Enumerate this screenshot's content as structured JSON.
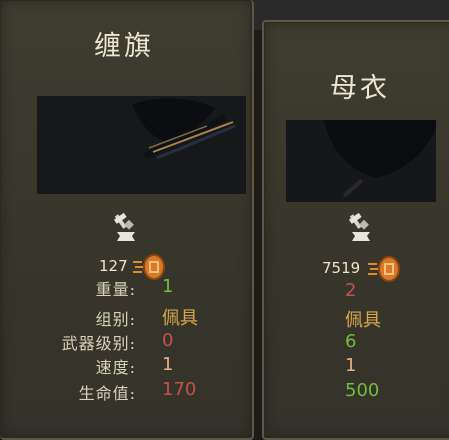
{
  "left_card": {
    "title": "缠旗",
    "price": "127",
    "stats": [
      {
        "label": "重量:",
        "value": "1",
        "color": "#6fbf3a"
      },
      {
        "label": "组别:",
        "value": "佩具",
        "color": "#d9a84a"
      },
      {
        "label": "武器级别:",
        "value": "0",
        "color": "#c4524a"
      },
      {
        "label": "速度:",
        "value": "1",
        "color": "#e7b07e"
      },
      {
        "label": "生命值:",
        "value": "170",
        "color": "#c4524a"
      }
    ]
  },
  "right_card": {
    "title": "母衣",
    "price": "7519",
    "stats": [
      {
        "value": "2",
        "color": "#c4524a"
      },
      {
        "value": "佩具",
        "color": "#d9a84a"
      },
      {
        "value": "6",
        "color": "#6fbf3a"
      },
      {
        "value": "1",
        "color": "#e7b07e"
      },
      {
        "value": "500",
        "color": "#6fbf3a"
      }
    ]
  },
  "icons": {
    "craft": "hammer-anvil-icon",
    "currency": "coin-stack-icon"
  }
}
